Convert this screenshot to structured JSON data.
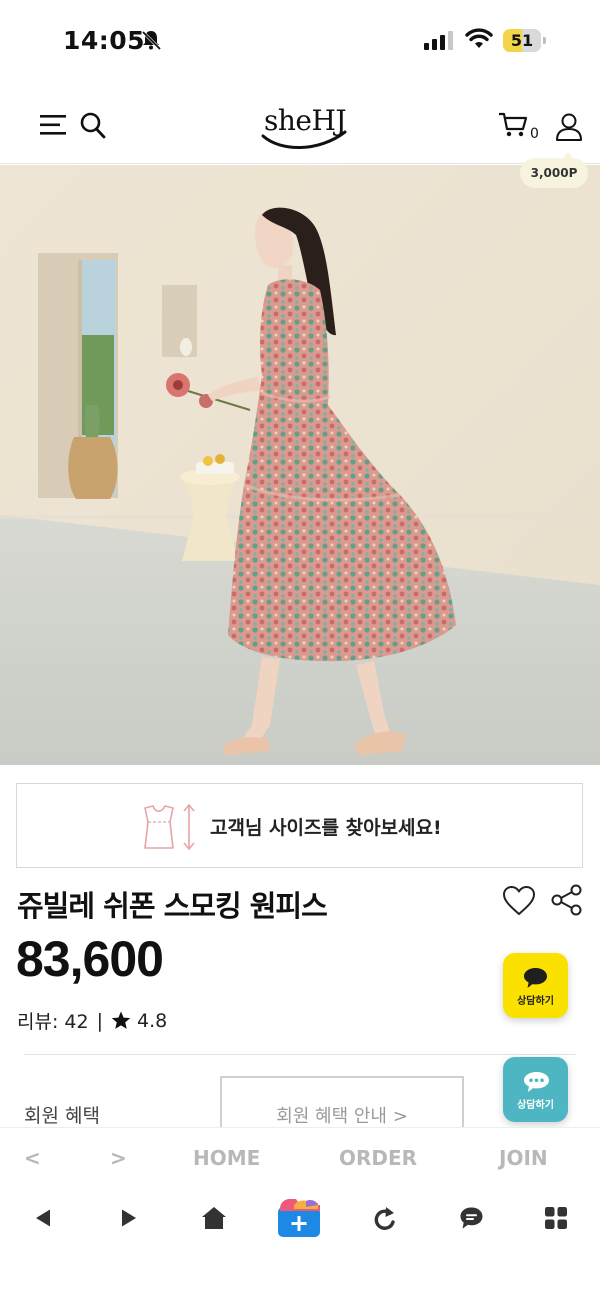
{
  "status_bar": {
    "time": "14:05",
    "battery_text": "51",
    "battery_level": 0.51
  },
  "header": {
    "logo_text": "sheHJ",
    "cart_count": "0",
    "points_badge": "3,000P"
  },
  "size_finder": {
    "label": "고객님 사이즈를 찾아보세요!"
  },
  "product": {
    "title": "쥬빌레 쉬폰 스모킹 원피스",
    "price": "83,600",
    "review_label": "리뷰: 42",
    "separator": "|",
    "rating": "4.8"
  },
  "benefits": {
    "label": "회원 혜택",
    "button_label": "회원 혜택 안내 >"
  },
  "floating_chat": {
    "kakao_label": "상담하기",
    "talk_label": "상담하기",
    "kakao_color": "#fae100",
    "talk_color": "#4db6c2"
  },
  "bottom_nav": {
    "prev": "<",
    "next": ">",
    "home": "HOME",
    "order": "ORDER",
    "join": "JOIN"
  },
  "toolbar": {
    "icons": [
      "back-icon",
      "forward-icon",
      "home-icon",
      "add-tab-icon",
      "refresh-icon",
      "chat-icon",
      "apps-grid-icon"
    ]
  }
}
